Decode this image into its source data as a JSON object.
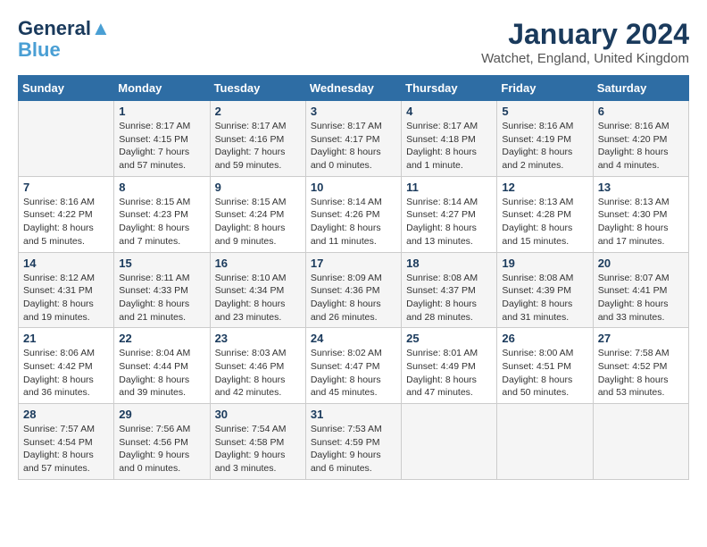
{
  "header": {
    "logo_line1": "General",
    "logo_line2": "Blue",
    "title": "January 2024",
    "subtitle": "Watchet, England, United Kingdom"
  },
  "columns": [
    "Sunday",
    "Monday",
    "Tuesday",
    "Wednesday",
    "Thursday",
    "Friday",
    "Saturday"
  ],
  "weeks": [
    [
      {
        "day": "",
        "sunrise": "",
        "sunset": "",
        "daylight": ""
      },
      {
        "day": "1",
        "sunrise": "Sunrise: 8:17 AM",
        "sunset": "Sunset: 4:15 PM",
        "daylight": "Daylight: 7 hours and 57 minutes."
      },
      {
        "day": "2",
        "sunrise": "Sunrise: 8:17 AM",
        "sunset": "Sunset: 4:16 PM",
        "daylight": "Daylight: 7 hours and 59 minutes."
      },
      {
        "day": "3",
        "sunrise": "Sunrise: 8:17 AM",
        "sunset": "Sunset: 4:17 PM",
        "daylight": "Daylight: 8 hours and 0 minutes."
      },
      {
        "day": "4",
        "sunrise": "Sunrise: 8:17 AM",
        "sunset": "Sunset: 4:18 PM",
        "daylight": "Daylight: 8 hours and 1 minute."
      },
      {
        "day": "5",
        "sunrise": "Sunrise: 8:16 AM",
        "sunset": "Sunset: 4:19 PM",
        "daylight": "Daylight: 8 hours and 2 minutes."
      },
      {
        "day": "6",
        "sunrise": "Sunrise: 8:16 AM",
        "sunset": "Sunset: 4:20 PM",
        "daylight": "Daylight: 8 hours and 4 minutes."
      }
    ],
    [
      {
        "day": "7",
        "sunrise": "Sunrise: 8:16 AM",
        "sunset": "Sunset: 4:22 PM",
        "daylight": "Daylight: 8 hours and 5 minutes."
      },
      {
        "day": "8",
        "sunrise": "Sunrise: 8:15 AM",
        "sunset": "Sunset: 4:23 PM",
        "daylight": "Daylight: 8 hours and 7 minutes."
      },
      {
        "day": "9",
        "sunrise": "Sunrise: 8:15 AM",
        "sunset": "Sunset: 4:24 PM",
        "daylight": "Daylight: 8 hours and 9 minutes."
      },
      {
        "day": "10",
        "sunrise": "Sunrise: 8:14 AM",
        "sunset": "Sunset: 4:26 PM",
        "daylight": "Daylight: 8 hours and 11 minutes."
      },
      {
        "day": "11",
        "sunrise": "Sunrise: 8:14 AM",
        "sunset": "Sunset: 4:27 PM",
        "daylight": "Daylight: 8 hours and 13 minutes."
      },
      {
        "day": "12",
        "sunrise": "Sunrise: 8:13 AM",
        "sunset": "Sunset: 4:28 PM",
        "daylight": "Daylight: 8 hours and 15 minutes."
      },
      {
        "day": "13",
        "sunrise": "Sunrise: 8:13 AM",
        "sunset": "Sunset: 4:30 PM",
        "daylight": "Daylight: 8 hours and 17 minutes."
      }
    ],
    [
      {
        "day": "14",
        "sunrise": "Sunrise: 8:12 AM",
        "sunset": "Sunset: 4:31 PM",
        "daylight": "Daylight: 8 hours and 19 minutes."
      },
      {
        "day": "15",
        "sunrise": "Sunrise: 8:11 AM",
        "sunset": "Sunset: 4:33 PM",
        "daylight": "Daylight: 8 hours and 21 minutes."
      },
      {
        "day": "16",
        "sunrise": "Sunrise: 8:10 AM",
        "sunset": "Sunset: 4:34 PM",
        "daylight": "Daylight: 8 hours and 23 minutes."
      },
      {
        "day": "17",
        "sunrise": "Sunrise: 8:09 AM",
        "sunset": "Sunset: 4:36 PM",
        "daylight": "Daylight: 8 hours and 26 minutes."
      },
      {
        "day": "18",
        "sunrise": "Sunrise: 8:08 AM",
        "sunset": "Sunset: 4:37 PM",
        "daylight": "Daylight: 8 hours and 28 minutes."
      },
      {
        "day": "19",
        "sunrise": "Sunrise: 8:08 AM",
        "sunset": "Sunset: 4:39 PM",
        "daylight": "Daylight: 8 hours and 31 minutes."
      },
      {
        "day": "20",
        "sunrise": "Sunrise: 8:07 AM",
        "sunset": "Sunset: 4:41 PM",
        "daylight": "Daylight: 8 hours and 33 minutes."
      }
    ],
    [
      {
        "day": "21",
        "sunrise": "Sunrise: 8:06 AM",
        "sunset": "Sunset: 4:42 PM",
        "daylight": "Daylight: 8 hours and 36 minutes."
      },
      {
        "day": "22",
        "sunrise": "Sunrise: 8:04 AM",
        "sunset": "Sunset: 4:44 PM",
        "daylight": "Daylight: 8 hours and 39 minutes."
      },
      {
        "day": "23",
        "sunrise": "Sunrise: 8:03 AM",
        "sunset": "Sunset: 4:46 PM",
        "daylight": "Daylight: 8 hours and 42 minutes."
      },
      {
        "day": "24",
        "sunrise": "Sunrise: 8:02 AM",
        "sunset": "Sunset: 4:47 PM",
        "daylight": "Daylight: 8 hours and 45 minutes."
      },
      {
        "day": "25",
        "sunrise": "Sunrise: 8:01 AM",
        "sunset": "Sunset: 4:49 PM",
        "daylight": "Daylight: 8 hours and 47 minutes."
      },
      {
        "day": "26",
        "sunrise": "Sunrise: 8:00 AM",
        "sunset": "Sunset: 4:51 PM",
        "daylight": "Daylight: 8 hours and 50 minutes."
      },
      {
        "day": "27",
        "sunrise": "Sunrise: 7:58 AM",
        "sunset": "Sunset: 4:52 PM",
        "daylight": "Daylight: 8 hours and 53 minutes."
      }
    ],
    [
      {
        "day": "28",
        "sunrise": "Sunrise: 7:57 AM",
        "sunset": "Sunset: 4:54 PM",
        "daylight": "Daylight: 8 hours and 57 minutes."
      },
      {
        "day": "29",
        "sunrise": "Sunrise: 7:56 AM",
        "sunset": "Sunset: 4:56 PM",
        "daylight": "Daylight: 9 hours and 0 minutes."
      },
      {
        "day": "30",
        "sunrise": "Sunrise: 7:54 AM",
        "sunset": "Sunset: 4:58 PM",
        "daylight": "Daylight: 9 hours and 3 minutes."
      },
      {
        "day": "31",
        "sunrise": "Sunrise: 7:53 AM",
        "sunset": "Sunset: 4:59 PM",
        "daylight": "Daylight: 9 hours and 6 minutes."
      },
      {
        "day": "",
        "sunrise": "",
        "sunset": "",
        "daylight": ""
      },
      {
        "day": "",
        "sunrise": "",
        "sunset": "",
        "daylight": ""
      },
      {
        "day": "",
        "sunrise": "",
        "sunset": "",
        "daylight": ""
      }
    ]
  ]
}
